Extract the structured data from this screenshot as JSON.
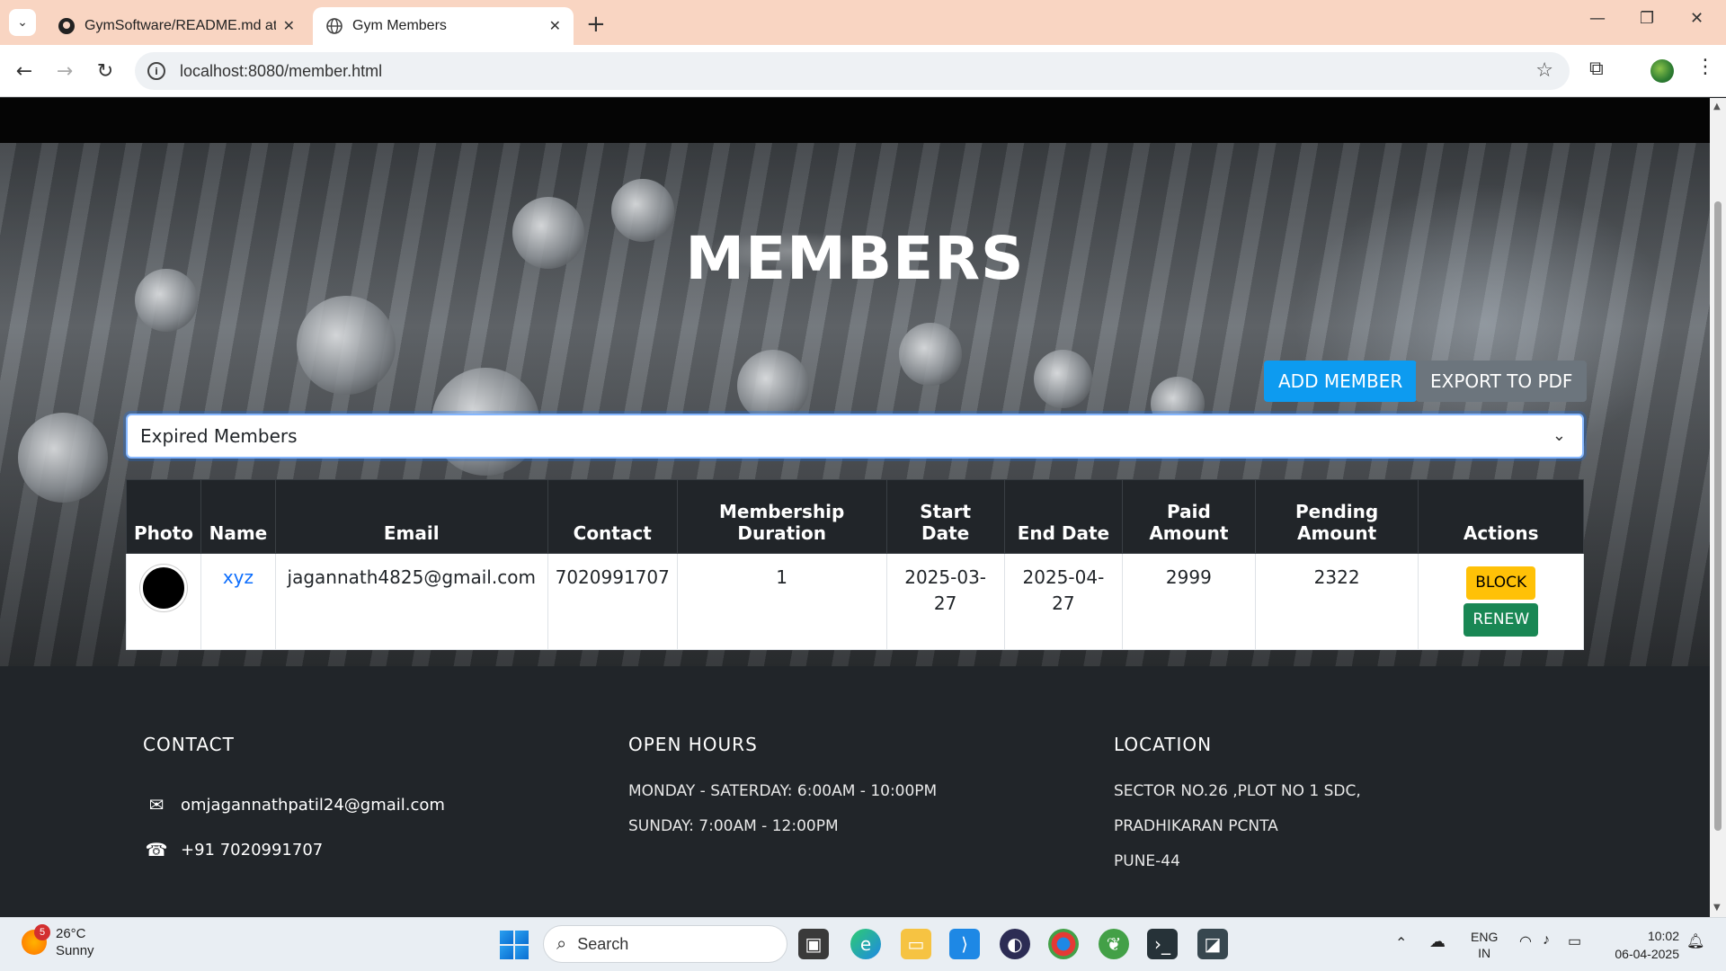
{
  "browser": {
    "tabs": [
      {
        "title": "GymSoftware/README.md at m",
        "icon": "github-icon"
      },
      {
        "title": "Gym Members",
        "icon": "globe-icon"
      }
    ],
    "url": "localhost:8080/member.html"
  },
  "page": {
    "title": "MEMBERS",
    "add_button": "ADD MEMBER",
    "export_button": "EXPORT TO PDF",
    "filter_selected": "Expired Members",
    "table": {
      "headers": {
        "photo": "Photo",
        "name": "Name",
        "email": "Email",
        "contact": "Contact",
        "duration": "Membership Duration",
        "start": "Start Date",
        "end": "End Date",
        "paid": "Paid Amount",
        "pending": "Pending Amount",
        "actions": "Actions"
      },
      "rows": [
        {
          "name": "xyz",
          "email": "jagannath4825@gmail.com",
          "contact": "7020991707",
          "duration": "1",
          "start": "2025-03-27",
          "end": "2025-04-27",
          "paid": "2999",
          "pending": "2322",
          "block_label": "BLOCK",
          "renew_label": "RENEW"
        }
      ]
    }
  },
  "footer": {
    "contact": {
      "heading": "CONTACT",
      "email": "omjagannathpatil24@gmail.com",
      "phone": "+91 7020991707"
    },
    "hours": {
      "heading": "OPEN HOURS",
      "lines": [
        "MONDAY - SATERDAY: 6:00AM - 10:00PM",
        "SUNDAY: 7:00AM - 12:00PM"
      ]
    },
    "location": {
      "heading": "LOCATION",
      "lines": [
        "SECTOR NO.26 ,PLOT NO 1 SDC,",
        "PRADHIKARAN PCNTA",
        "PUNE-44"
      ]
    }
  },
  "taskbar": {
    "weather_temp": "26°C",
    "weather_text": "Sunny",
    "weather_badge": "5",
    "search_placeholder": "Search",
    "lang_top": "ENG",
    "lang_bottom": "IN",
    "time": "10:02",
    "date": "06-04-2025"
  }
}
